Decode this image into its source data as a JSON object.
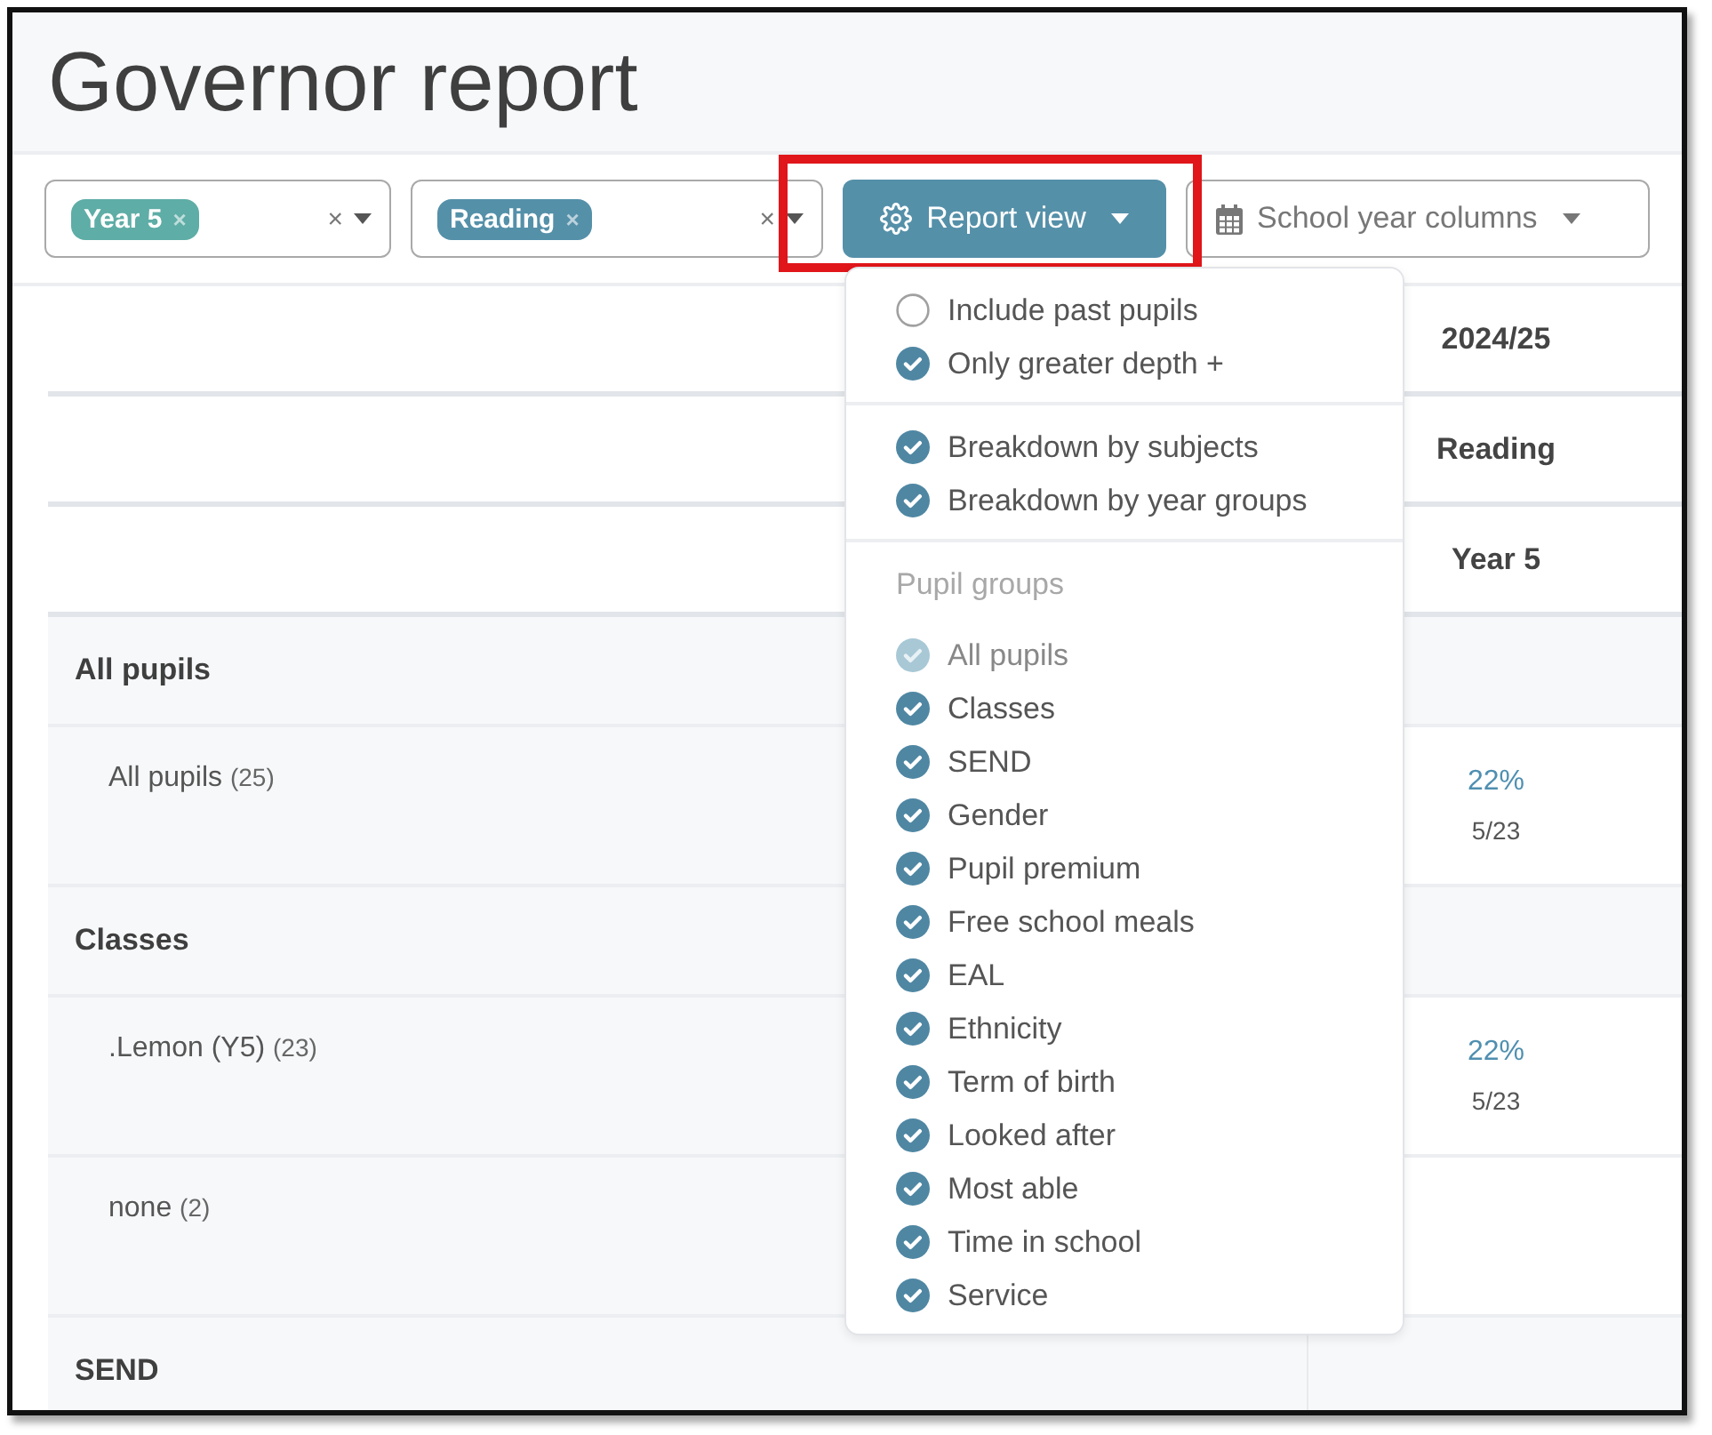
{
  "page": {
    "title": "Governor report"
  },
  "filters": [
    {
      "tags": [
        {
          "label": "Year 5",
          "remove": "×",
          "color": "#5eada6"
        }
      ],
      "clear": "×"
    },
    {
      "tags": [
        {
          "label": "Reading",
          "remove": "×",
          "color": "#5590a9"
        }
      ],
      "clear": "×"
    }
  ],
  "report_view_button": {
    "label": "Report view",
    "highlighted": true
  },
  "columns_button": {
    "label": "School year columns"
  },
  "menu": {
    "sections": [
      {
        "items": [
          {
            "label": "Include past pupils",
            "checked": false,
            "disabled": false
          },
          {
            "label": "Only greater depth +",
            "checked": true,
            "disabled": false
          }
        ]
      },
      {
        "items": [
          {
            "label": "Breakdown by subjects",
            "checked": true,
            "disabled": false
          },
          {
            "label": "Breakdown by year groups",
            "checked": true,
            "disabled": false
          }
        ]
      },
      {
        "heading": "Pupil groups",
        "items": [
          {
            "label": "All pupils",
            "checked": true,
            "disabled": true
          },
          {
            "label": "Classes",
            "checked": true,
            "disabled": false
          },
          {
            "label": "SEND",
            "checked": true,
            "disabled": false
          },
          {
            "label": "Gender",
            "checked": true,
            "disabled": false
          },
          {
            "label": "Pupil premium",
            "checked": true,
            "disabled": false
          },
          {
            "label": "Free school meals",
            "checked": true,
            "disabled": false
          },
          {
            "label": "EAL",
            "checked": true,
            "disabled": false
          },
          {
            "label": "Ethnicity",
            "checked": true,
            "disabled": false
          },
          {
            "label": "Term of birth",
            "checked": true,
            "disabled": false
          },
          {
            "label": "Looked after",
            "checked": true,
            "disabled": false
          },
          {
            "label": "Most able",
            "checked": true,
            "disabled": false
          },
          {
            "label": "Time in school",
            "checked": true,
            "disabled": false
          },
          {
            "label": "Service",
            "checked": true,
            "disabled": false
          }
        ]
      }
    ]
  },
  "table": {
    "header_rows": [
      "2024/25",
      "Reading",
      "Year 5"
    ],
    "groups": [
      {
        "title": "All pupils",
        "rows": [
          {
            "label": "All pupils",
            "count": "(25)",
            "percent": "22%",
            "fraction": "5/23"
          }
        ]
      },
      {
        "title": "Classes",
        "rows": [
          {
            "label": ".Lemon (Y5)",
            "count": "(23)",
            "percent": "22%",
            "fraction": "5/23"
          },
          {
            "label": "none",
            "count": "(2)"
          }
        ]
      },
      {
        "title": "SEND"
      }
    ]
  }
}
